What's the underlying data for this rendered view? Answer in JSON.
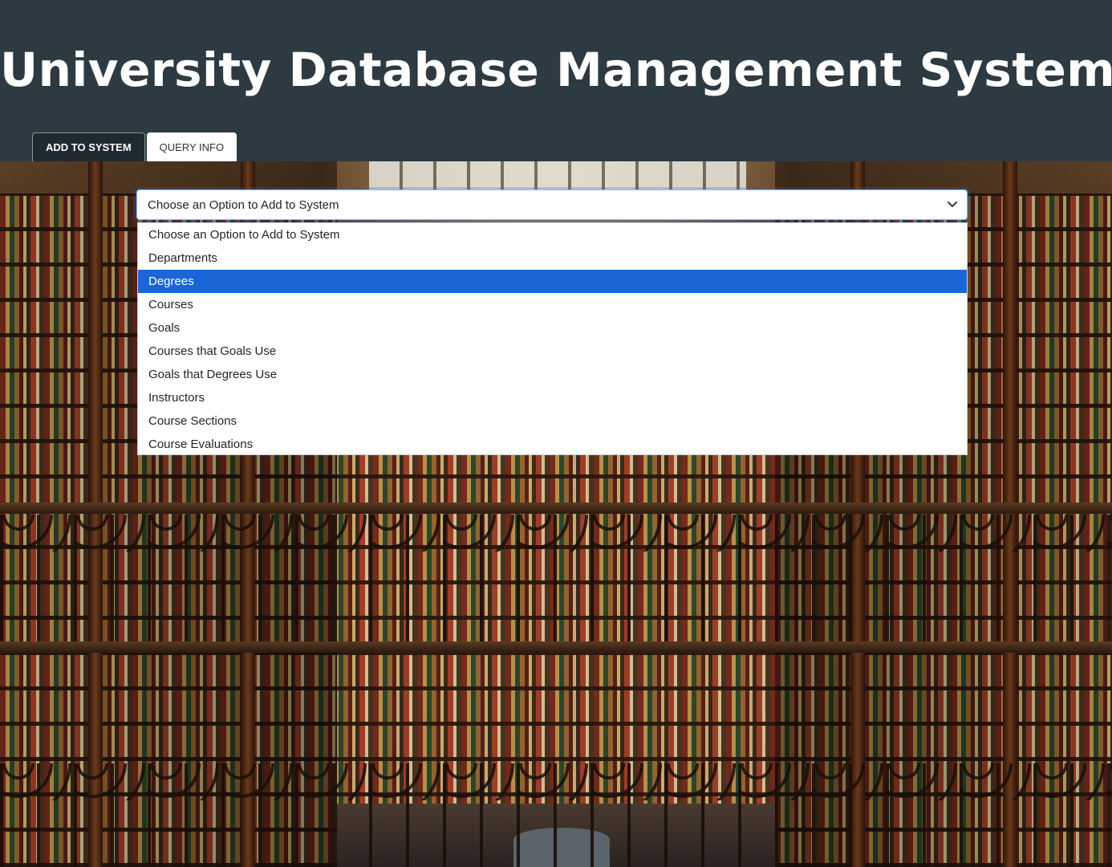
{
  "header": {
    "title": "University Database Management System",
    "background": "#2e3a42"
  },
  "tabs": [
    {
      "label": "ADD TO SYSTEM",
      "active": true
    },
    {
      "label": "QUERY INFO",
      "active": false
    }
  ],
  "select": {
    "value": "Choose an Option to Add to System",
    "chevron_icon": "chevron-down-icon",
    "options": [
      "Choose an Option to Add to System",
      "Departments",
      "Degrees",
      "Courses",
      "Goals",
      "Courses that Goals Use",
      "Goals that Degrees Use",
      "Instructors",
      "Course Sections",
      "Course Evaluations"
    ],
    "highlighted": "Degrees",
    "highlight_color": "#1a66d6"
  },
  "background_image": "library-interior"
}
